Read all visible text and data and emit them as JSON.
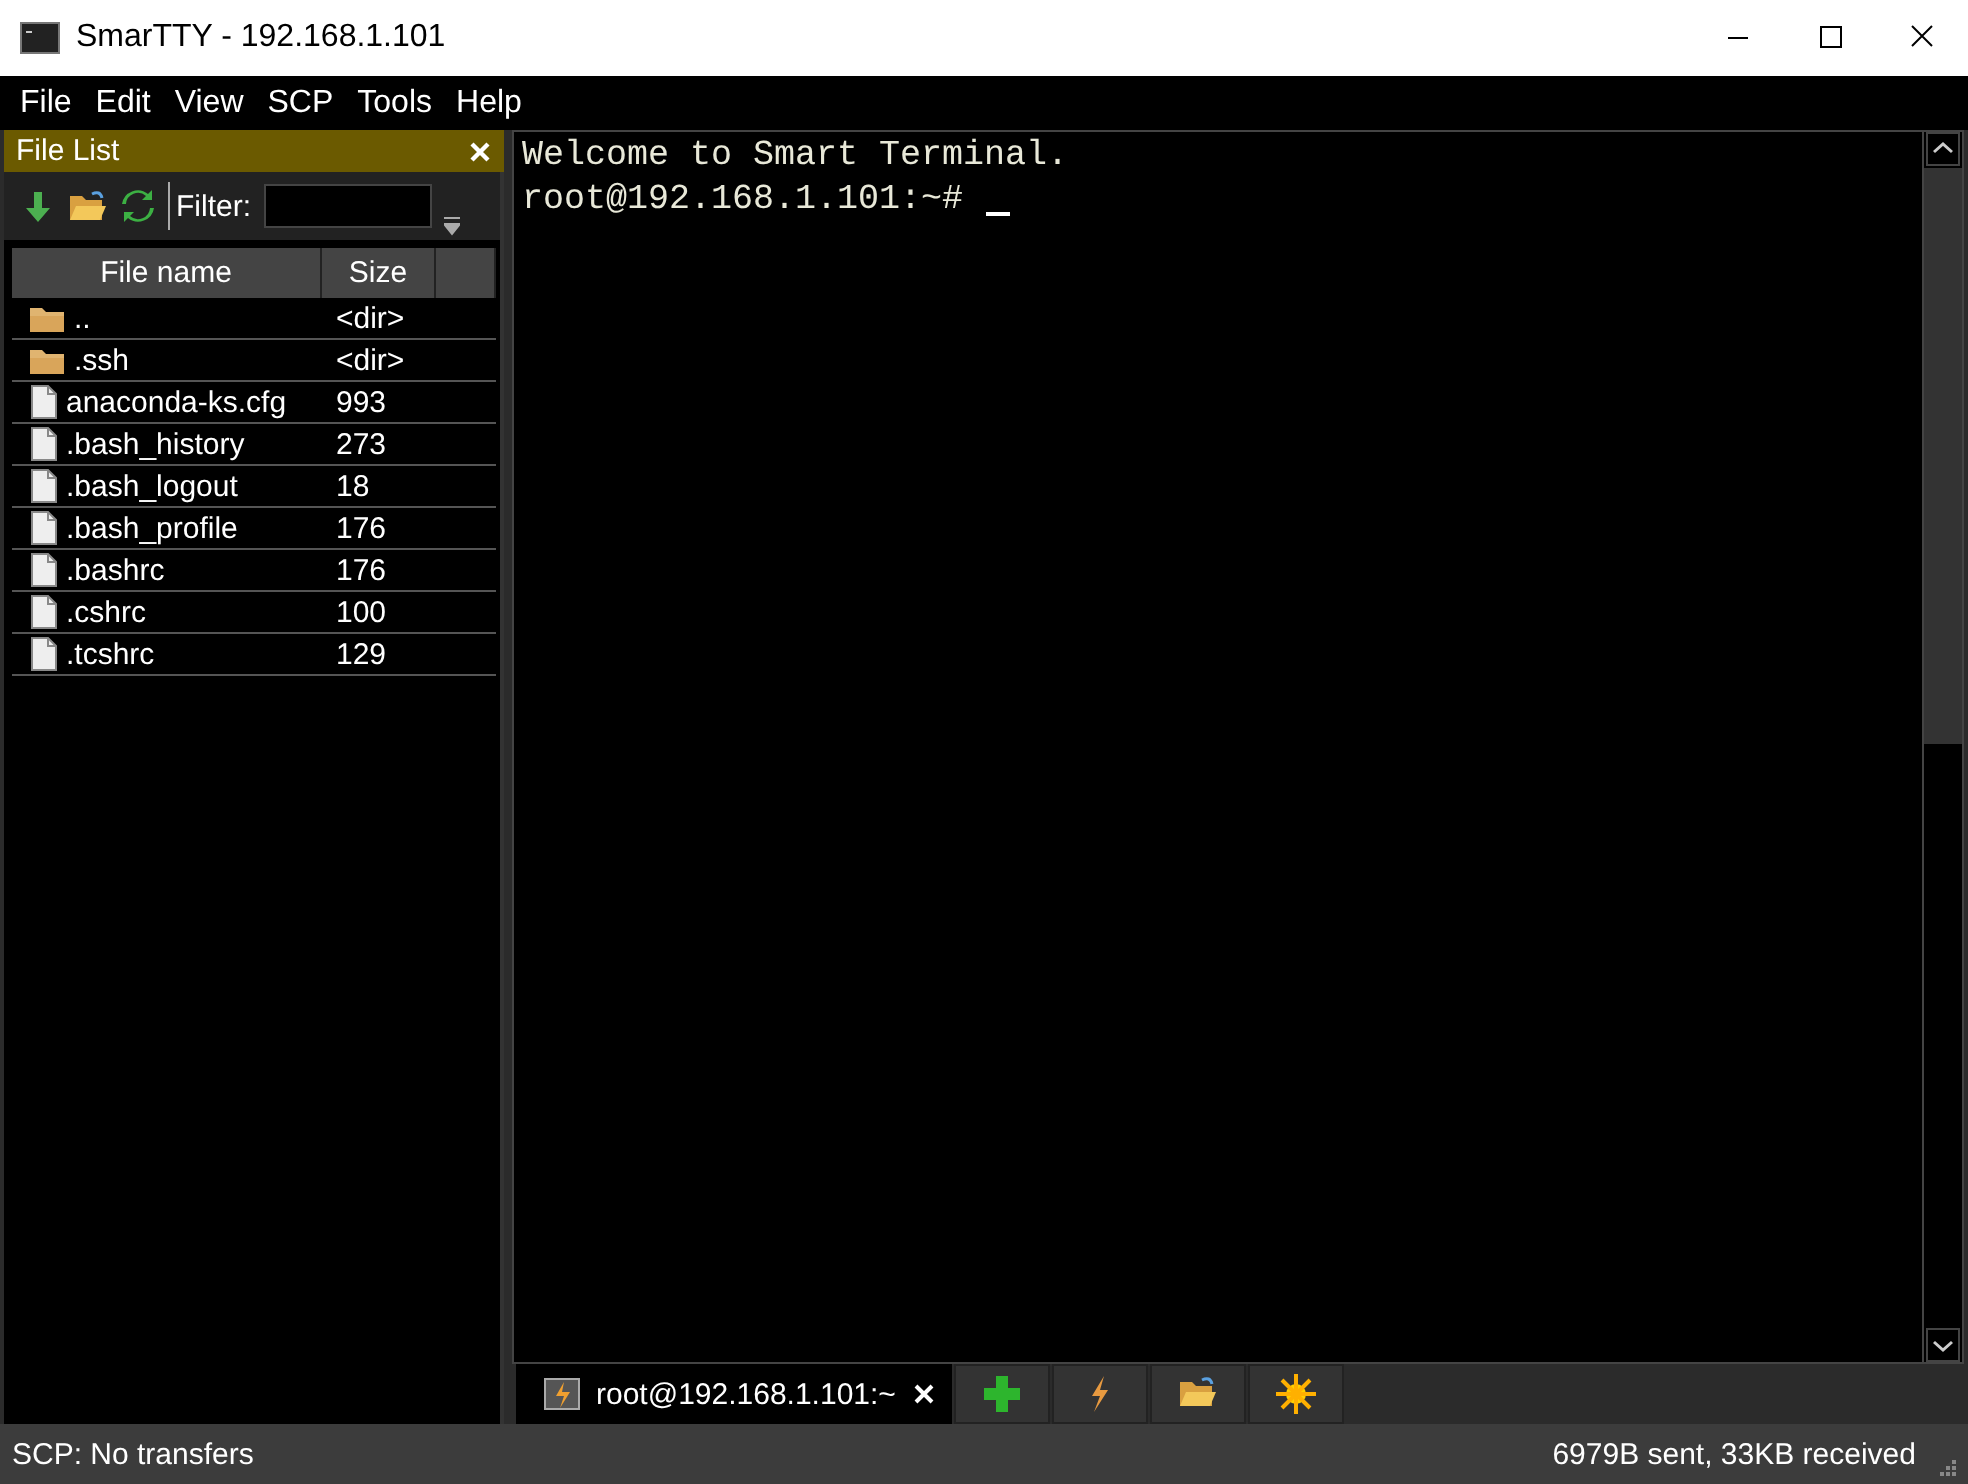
{
  "window": {
    "title": "SmarTTY - 192.168.1.101"
  },
  "menu": [
    "File",
    "Edit",
    "View",
    "SCP",
    "Tools",
    "Help"
  ],
  "file_list": {
    "title": "File List",
    "filter_label": "Filter:",
    "columns": [
      "File name",
      "Size"
    ],
    "rows": [
      {
        "kind": "folder",
        "name": "..",
        "size": "<dir>"
      },
      {
        "kind": "folder",
        "name": ".ssh",
        "size": "<dir>"
      },
      {
        "kind": "file",
        "name": "anaconda-ks.cfg",
        "size": "993"
      },
      {
        "kind": "file",
        "name": ".bash_history",
        "size": "273"
      },
      {
        "kind": "file",
        "name": ".bash_logout",
        "size": "18"
      },
      {
        "kind": "file",
        "name": ".bash_profile",
        "size": "176"
      },
      {
        "kind": "file",
        "name": ".bashrc",
        "size": "176"
      },
      {
        "kind": "file",
        "name": ".cshrc",
        "size": "100"
      },
      {
        "kind": "file",
        "name": ".tcshrc",
        "size": "129"
      }
    ]
  },
  "terminal": {
    "lines": [
      {
        "text": "Welcome to Smart Terminal.",
        "cursor": false
      },
      {
        "text": "root@192.168.1.101:~#",
        "cursor": true
      }
    ]
  },
  "tabs": [
    {
      "label": "root@192.168.1.101:~",
      "selected": true
    }
  ],
  "status_bar": {
    "left": "SCP: No transfers",
    "right": "6979B sent, 33KB received"
  }
}
